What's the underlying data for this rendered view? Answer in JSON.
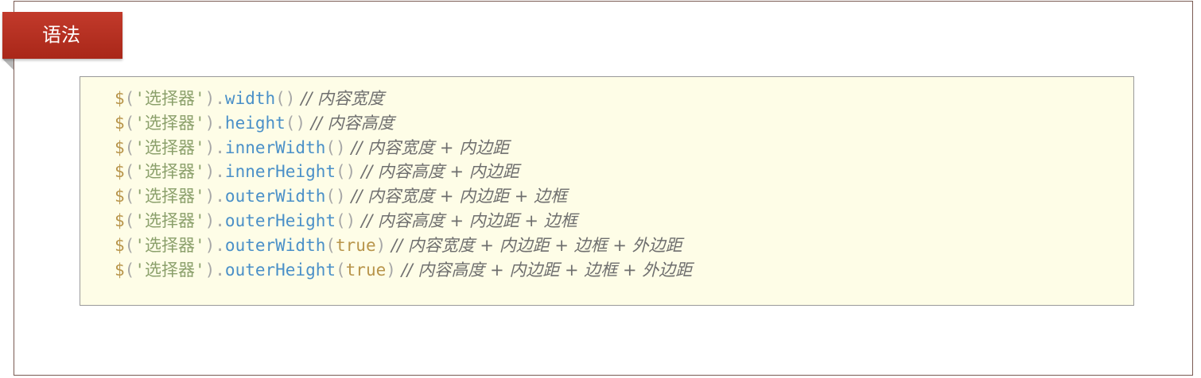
{
  "tag": {
    "label": "语法"
  },
  "code_lines": [
    {
      "dollar": "$",
      "open": "(",
      "selector": "'选择器'",
      "close": ")",
      "dot": ".",
      "method": "width",
      "arg_open": "(",
      "arg": "",
      "arg_close": ")",
      "comment": " // 内容宽度"
    },
    {
      "dollar": "$",
      "open": "(",
      "selector": "'选择器'",
      "close": ")",
      "dot": ".",
      "method": "height",
      "arg_open": "(",
      "arg": "",
      "arg_close": ")",
      "comment": " // 内容高度"
    },
    {
      "dollar": "$",
      "open": "(",
      "selector": "'选择器'",
      "close": ")",
      "dot": ".",
      "method": "innerWidth",
      "arg_open": "(",
      "arg": "",
      "arg_close": ")",
      "comment": " // 内容宽度 + 内边距"
    },
    {
      "dollar": "$",
      "open": "(",
      "selector": "'选择器'",
      "close": ")",
      "dot": ".",
      "method": "innerHeight",
      "arg_open": "(",
      "arg": "",
      "arg_close": ")",
      "comment": " // 内容高度 + 内边距"
    },
    {
      "dollar": "$",
      "open": "(",
      "selector": "'选择器'",
      "close": ")",
      "dot": ".",
      "method": "outerWidth",
      "arg_open": "(",
      "arg": "",
      "arg_close": ")",
      "comment": " // 内容宽度 + 内边距 + 边框"
    },
    {
      "dollar": "$",
      "open": "(",
      "selector": "'选择器'",
      "close": ")",
      "dot": ".",
      "method": "outerHeight",
      "arg_open": "(",
      "arg": "",
      "arg_close": ")",
      "comment": " // 内容高度 + 内边距 + 边框"
    },
    {
      "dollar": "$",
      "open": "(",
      "selector": "'选择器'",
      "close": ")",
      "dot": ".",
      "method": "outerWidth",
      "arg_open": "(",
      "arg": "true",
      "arg_close": ")",
      "comment": " // 内容宽度 + 内边距 + 边框 + 外边距"
    },
    {
      "dollar": "$",
      "open": "(",
      "selector": "'选择器'",
      "close": ")",
      "dot": ".",
      "method": "outerHeight",
      "arg_open": "(",
      "arg": "true",
      "arg_close": ")",
      "comment": " // 内容高度 + 内边距 + 边框 + 外边距"
    }
  ],
  "colors": {
    "tag_background": "#b22f21",
    "code_background": "#fefde7",
    "method": "#4a90c8",
    "string": "#8ba06b",
    "keyword": "#b8954b",
    "comment": "#6e6e6e"
  }
}
